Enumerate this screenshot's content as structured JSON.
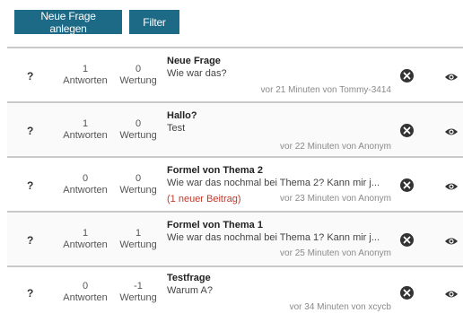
{
  "toolbar": {
    "new_question_label": "Neue Frage anlegen",
    "filter_label": "Filter"
  },
  "columns": {
    "answers_label": "Antworten",
    "votes_label": "Wertung"
  },
  "status_symbol": "?",
  "icons": {
    "delete": "delete-circle-x",
    "view": "eye"
  },
  "colors": {
    "button_bg": "#1d6a86",
    "new_post": "#c0392b"
  },
  "questions": [
    {
      "status": "?",
      "answers": "1",
      "answers_label": "Antworten",
      "votes": "0",
      "votes_label": "Wertung",
      "title": "Neue Frage",
      "text": "Wie war das?",
      "new_posts": "",
      "meta": "vor 21 Minuten von Tommy-3414"
    },
    {
      "status": "?",
      "answers": "1",
      "answers_label": "Antworten",
      "votes": "0",
      "votes_label": "Wertung",
      "title": "Hallo?",
      "text": "Test",
      "new_posts": "",
      "meta": "vor 22 Minuten von Anonym"
    },
    {
      "status": "?",
      "answers": "0",
      "answers_label": "Antworten",
      "votes": "0",
      "votes_label": "Wertung",
      "title": "Formel von Thema 2",
      "text": "Wie war das nochmal bei Thema 2? Kann mir j...",
      "new_posts": "(1 neuer Beitrag)",
      "meta": "vor 23 Minuten von Anonym"
    },
    {
      "status": "?",
      "answers": "1",
      "answers_label": "Antworten",
      "votes": "1",
      "votes_label": "Wertung",
      "title": "Formel von Thema 1",
      "text": "Wie war das nochmal bei Thema 1? Kann mir j...",
      "new_posts": "",
      "meta": "vor 25 Minuten von Anonym"
    },
    {
      "status": "?",
      "answers": "0",
      "answers_label": "Antworten",
      "votes": "-1",
      "votes_label": "Wertung",
      "title": "Testfrage",
      "text": "Warum A?",
      "new_posts": "",
      "meta": "vor 34 Minuten von xcycb"
    }
  ]
}
